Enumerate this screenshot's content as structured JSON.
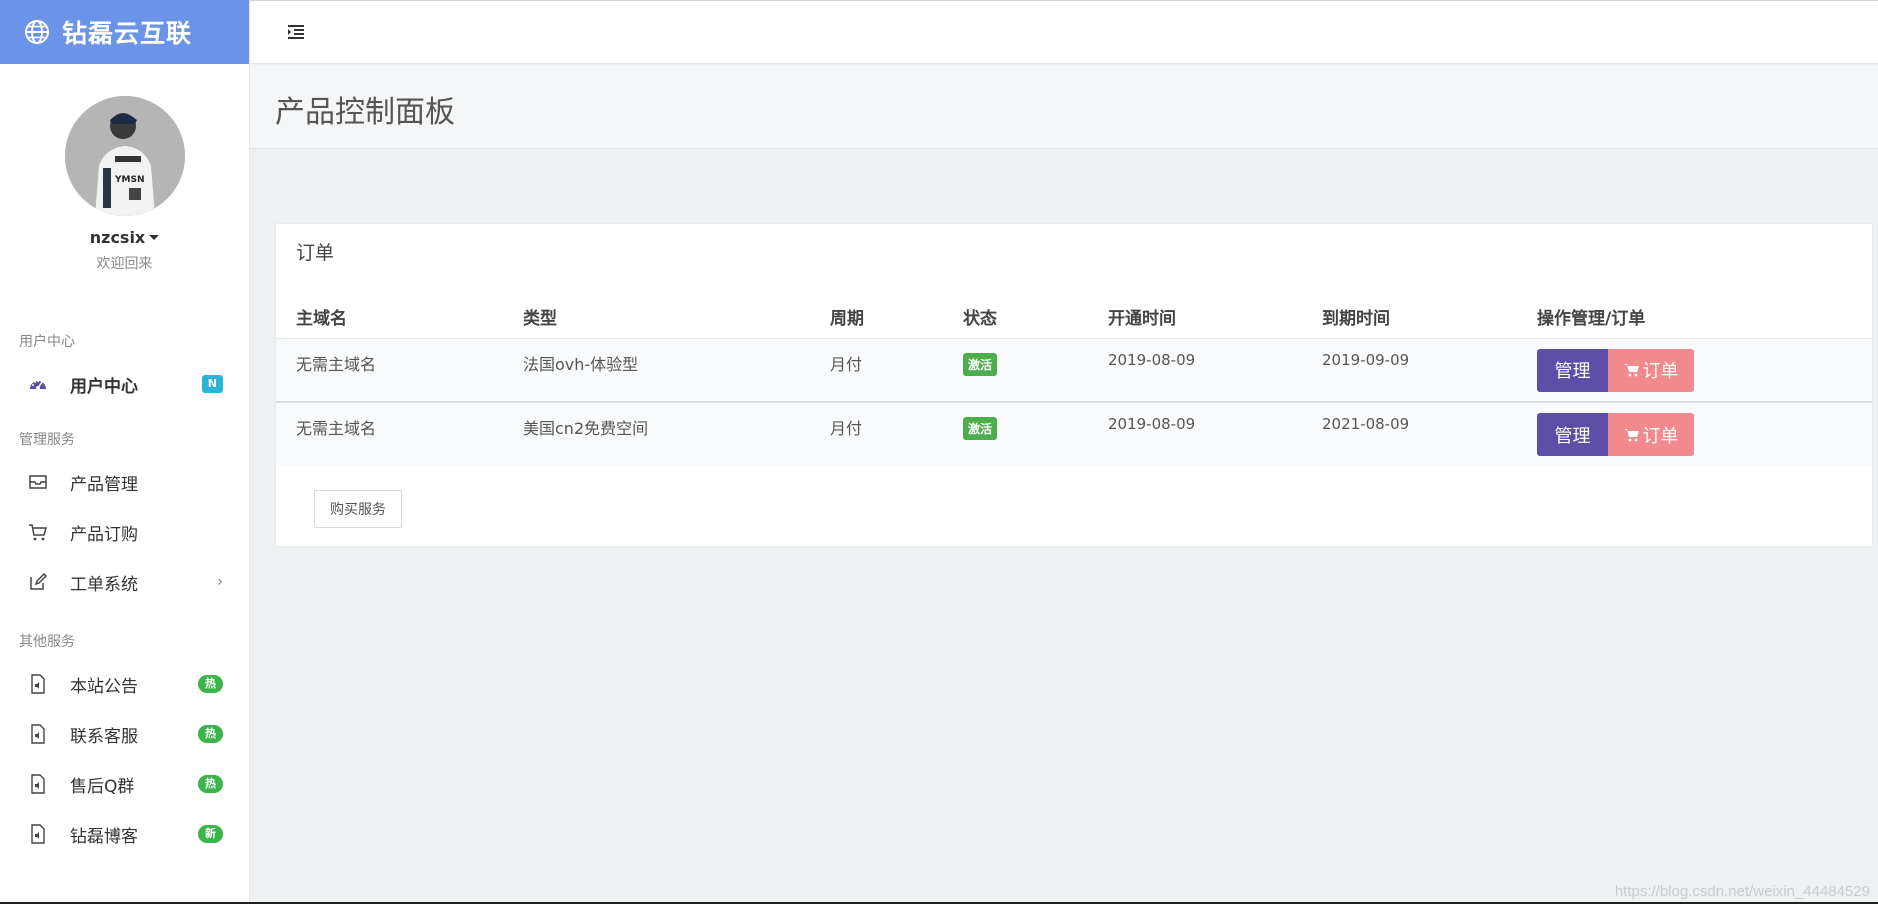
{
  "brand": {
    "name": "钻磊云互联",
    "icon": "globe-icon"
  },
  "profile": {
    "username": "nzcsix",
    "welcome": "欢迎回来"
  },
  "sidebar": {
    "sections": [
      {
        "title": "用户中心"
      },
      {
        "title": "管理服务"
      },
      {
        "title": "其他服务"
      }
    ],
    "items": [
      {
        "label": "用户中心",
        "icon": "dashboard-icon",
        "badge": "N"
      },
      {
        "label": "产品管理",
        "icon": "inbox-icon"
      },
      {
        "label": "产品订购",
        "icon": "cart-icon"
      },
      {
        "label": "工单系统",
        "icon": "edit-icon"
      },
      {
        "label": "本站公告",
        "icon": "audio-file-icon",
        "badge": "热"
      },
      {
        "label": "联系客服",
        "icon": "audio-file-icon",
        "badge": "热"
      },
      {
        "label": "售后Q群",
        "icon": "audio-file-icon",
        "badge": "热"
      },
      {
        "label": "钻磊博客",
        "icon": "audio-file-icon",
        "badge": "新"
      }
    ]
  },
  "page": {
    "title": "产品控制面板"
  },
  "orders": {
    "title": "订单",
    "columns": [
      "主域名",
      "类型",
      "周期",
      "状态",
      "开通时间",
      "到期时间",
      "操作管理/订单"
    ],
    "rows": [
      {
        "domain": "无需主域名",
        "type": "法国ovh-体验型",
        "cycle": "月付",
        "status": "激活",
        "start": "2019-08-09",
        "end": "2019-09-09",
        "manage": "管理",
        "order": "订单"
      },
      {
        "domain": "无需主域名",
        "type": "美国cn2免费空间",
        "cycle": "月付",
        "status": "激活",
        "start": "2019-08-09",
        "end": "2021-08-09",
        "manage": "管理",
        "order": "订单"
      }
    ],
    "buy_label": "购买服务"
  },
  "watermark": "https://blog.csdn.net/weixin_44484529",
  "colors": {
    "brand": "#6b93e8",
    "manage": "#5d4fa8",
    "order": "#f08a8f",
    "status": "#4cae4c",
    "badge_hot": "#3ab54a",
    "badge_new": "#2bb4d8"
  }
}
